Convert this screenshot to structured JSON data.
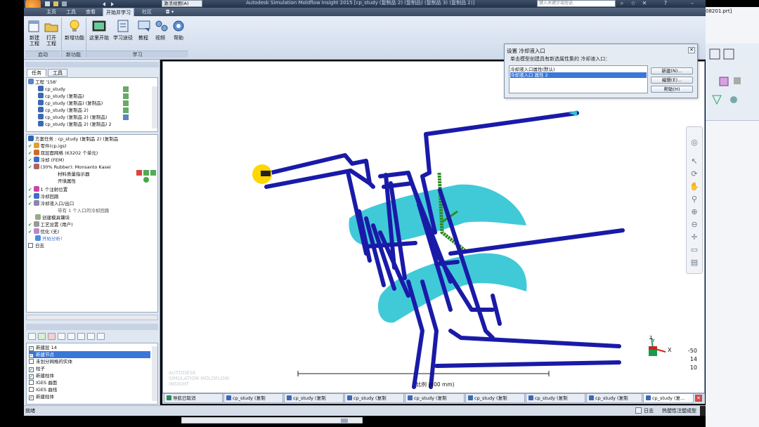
{
  "window": {
    "app_badge": "MF",
    "title": "Autodesk Simulation Moldflow Insight 2015   [cp_study (复制品 2) (复制品) (复制品 3) (复制品 2)]",
    "quick_access_dropdown": "激活视图(A)",
    "search_placeholder": "键入关键字或短语"
  },
  "ribbon_tabs": [
    "主页",
    "工具",
    "查看",
    "开始并学习",
    "社区"
  ],
  "active_ribbon_tab": "开始并学习",
  "ribbon": {
    "groups": [
      {
        "label": "启动",
        "buttons": [
          "新建\n工程",
          "打开\n工程"
        ]
      },
      {
        "label": "新功能",
        "buttons": [
          "新增功能"
        ]
      },
      {
        "label": "学习",
        "buttons": [
          "这里开始",
          "学习途径",
          "教程",
          "视频",
          "帮助"
        ]
      }
    ]
  },
  "left_panel": {
    "tabs": [
      "任务",
      "工具"
    ],
    "project": {
      "root": "工程 '158'",
      "items": [
        "cp_study",
        "cp_study (复制品)",
        "cp_study (复制品) (复制品)",
        "cp_study (复制品 2)",
        "cp_study (复制品 2) (复制品)",
        "cp_study (复制品 2) (复制品) 2"
      ]
    },
    "tasks": [
      {
        "text": "方案任务 : cp_study (复制品 2) (复制品",
        "check": false
      },
      {
        "text": "零件(cp.igs)",
        "check": true
      },
      {
        "text": "双层面网格 (63202 个单元)",
        "check": true
      },
      {
        "text": "冷却 (FEM)",
        "check": true
      },
      {
        "text": "(30% Rubber): Monsanto Kasei",
        "check": true
      },
      {
        "text": "材料质量指示器",
        "check": false
      },
      {
        "text": "开填属性",
        "check": false
      },
      {
        "text": "1 个注射位置",
        "check": true
      },
      {
        "text": "冷却回路",
        "check": true
      },
      {
        "text": "冷却液入口/出口",
        "check": true
      },
      {
        "text": "带有 1 个入口的冷却回路",
        "check": false
      },
      {
        "text": "创建模具镶块",
        "check": false
      },
      {
        "text": "工艺设置 (用户)",
        "check": true
      },
      {
        "text": "优化 (无)",
        "check": true
      },
      {
        "text": "开始分析!",
        "check": false
      },
      {
        "text": "日志",
        "check": false
      }
    ],
    "layers": [
      {
        "name": "新建层 14",
        "checked": true,
        "selected": false
      },
      {
        "name": "新建节点",
        "checked": true,
        "selected": true
      },
      {
        "name": "未划分网格的实体",
        "checked": false,
        "selected": false
      },
      {
        "name": "柱子",
        "checked": true,
        "selected": false
      },
      {
        "name": "新建柱体",
        "checked": true,
        "selected": false
      },
      {
        "name": "IGES 曲面",
        "checked": false,
        "selected": false
      },
      {
        "name": "IGES 曲线",
        "checked": false,
        "selected": false
      },
      {
        "name": "新建柱体",
        "checked": true,
        "selected": false
      }
    ]
  },
  "dialog": {
    "title": "设置 冷却液入口",
    "instruction": "单击模型创建具有新选属性集的 冷却液入口：",
    "items": [
      "冷却液入口属性(默认)",
      "冷却液入口 属性 2"
    ],
    "selected_index": 1,
    "buttons": [
      "新建(N)...",
      "编辑(E)...",
      "帮助(H)"
    ]
  },
  "viewport": {
    "watermark": "AUTODESK\nSIMULATION MOLDFLOW\nINSIGHT",
    "scale_label": "比例 (400 mm)",
    "axis_x": "X",
    "axis_y": "Y",
    "axis_z": "Z",
    "orientation": [
      "-50",
      "14",
      "10"
    ]
  },
  "bottom_tabs": [
    "导航已取消",
    "cp_study (复制",
    "cp_study (复制",
    "cp_study (复制",
    "cp_study (复制",
    "cp_study (复制",
    "cp_study (复制",
    "cp_study (复制",
    "cp_study (复制",
    "cp_study (复..."
  ],
  "active_bottom_tab": 9,
  "status": {
    "left": "就绪",
    "log": "日志",
    "layer": "热塑性注塑成型"
  },
  "right_strip": {
    "file_label": "08201.prt]"
  },
  "colors": {
    "pipe": "#1a1aa8",
    "part": "#2bc4d4",
    "gate": "#2e8b22",
    "highlight": "#ffd700",
    "selection": "#3a78d8"
  }
}
